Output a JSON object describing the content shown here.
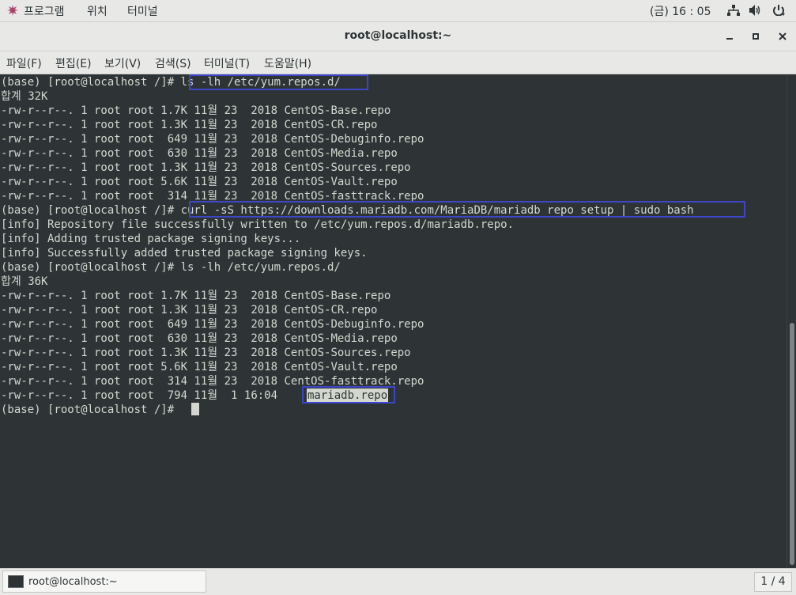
{
  "top_panel": {
    "apps_label": "프로그램",
    "places_label": "위치",
    "terminal_label": "터미널",
    "clock": "(금) 16 : 05"
  },
  "window": {
    "title": "root@localhost:~"
  },
  "menu": [
    "파일(F)",
    "편집(E)",
    "보기(V)",
    "검색(S)",
    "터미널(T)",
    "도움말(H)"
  ],
  "terminal_lines": [
    "(base) [root@localhost /]# ls -lh /etc/yum.repos.d/",
    "합계 32K",
    "-rw-r--r--. 1 root root 1.7K 11월 23  2018 CentOS-Base.repo",
    "-rw-r--r--. 1 root root 1.3K 11월 23  2018 CentOS-CR.repo",
    "-rw-r--r--. 1 root root  649 11월 23  2018 CentOS-Debuginfo.repo",
    "-rw-r--r--. 1 root root  630 11월 23  2018 CentOS-Media.repo",
    "-rw-r--r--. 1 root root 1.3K 11월 23  2018 CentOS-Sources.repo",
    "-rw-r--r--. 1 root root 5.6K 11월 23  2018 CentOS-Vault.repo",
    "-rw-r--r--. 1 root root  314 11월 23  2018 CentOS-fasttrack.repo",
    "(base) [root@localhost /]# curl -sS https://downloads.mariadb.com/MariaDB/mariadb_repo_setup | sudo bash",
    "[info] Repository file successfully written to /etc/yum.repos.d/mariadb.repo.",
    "[info] Adding trusted package signing keys...",
    "[info] Successfully added trusted package signing keys.",
    "(base) [root@localhost /]# ls -lh /etc/yum.repos.d/",
    "합계 36K",
    "-rw-r--r--. 1 root root 1.7K 11월 23  2018 CentOS-Base.repo",
    "-rw-r--r--. 1 root root 1.3K 11월 23  2018 CentOS-CR.repo",
    "-rw-r--r--. 1 root root  649 11월 23  2018 CentOS-Debuginfo.repo",
    "-rw-r--r--. 1 root root  630 11월 23  2018 CentOS-Media.repo",
    "-rw-r--r--. 1 root root 1.3K 11월 23  2018 CentOS-Sources.repo",
    "-rw-r--r--. 1 root root 5.6K 11월 23  2018 CentOS-Vault.repo",
    "-rw-r--r--. 1 root root  314 11월 23  2018 CentOS-fasttrack.repo",
    "-rw-r--r--. 1 root root  794 11월  1 16:04 ",
    "(base) [root@localhost /]# "
  ],
  "selected_text": "mariadb.repo",
  "taskbar": {
    "task_label": "root@localhost:~",
    "pager": "1 / 4"
  },
  "colors": {
    "terminal_bg": "#2e3436",
    "terminal_fg": "#d3d7cf",
    "highlight_box": "#3d46c6"
  }
}
